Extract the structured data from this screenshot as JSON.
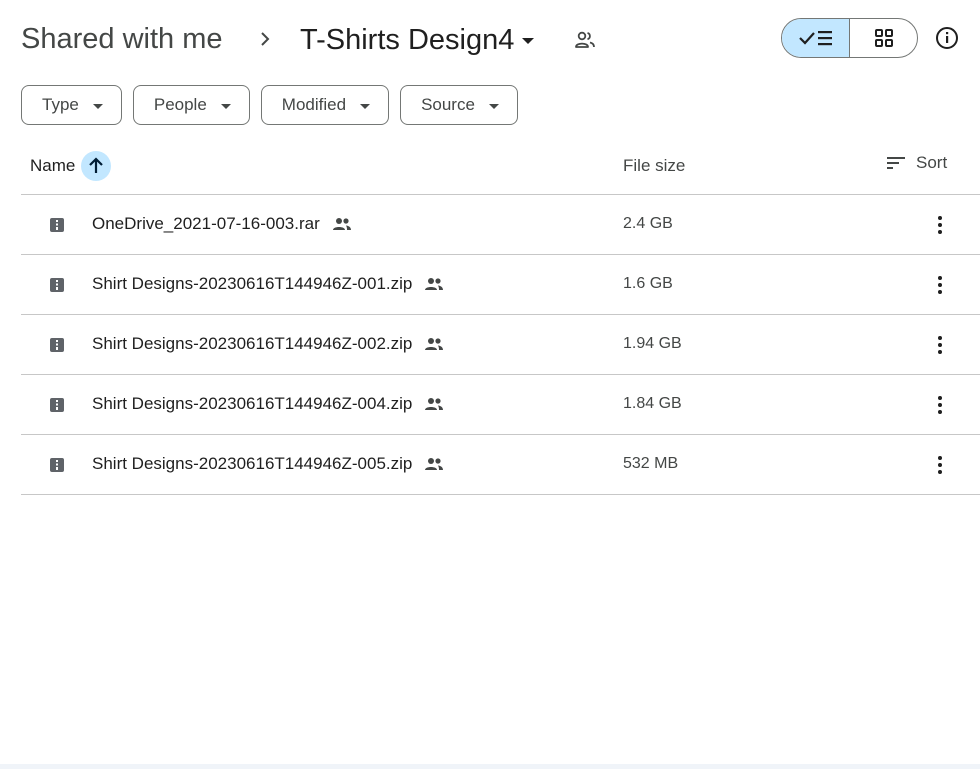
{
  "breadcrumb": {
    "root": "Shared with me",
    "current": "T-Shirts Design4"
  },
  "icons": {
    "separator": "chevron-right-icon",
    "folder_dropdown": "caret-down-icon",
    "shared": "people-icon",
    "list_view": "check-list-icon",
    "grid_view": "grid-icon",
    "info": "info-icon",
    "file": "archive-file-icon",
    "more": "more-vert-icon",
    "sort_dir": "arrow-up-icon",
    "sort": "sort-lines-icon"
  },
  "filters": [
    {
      "label": "Type"
    },
    {
      "label": "People"
    },
    {
      "label": "Modified"
    },
    {
      "label": "Source"
    }
  ],
  "table": {
    "columns": {
      "name": "Name",
      "size": "File size",
      "sort": "Sort"
    },
    "rows": [
      {
        "name": "OneDrive_2021-07-16-003.rar",
        "size": "2.4 GB"
      },
      {
        "name": "Shirt Designs-20230616T144946Z-001.zip",
        "size": "1.6 GB"
      },
      {
        "name": "Shirt Designs-20230616T144946Z-002.zip",
        "size": "1.94 GB"
      },
      {
        "name": "Shirt Designs-20230616T144946Z-004.zip",
        "size": "1.84 GB"
      },
      {
        "name": "Shirt Designs-20230616T144946Z-005.zip",
        "size": "532 MB"
      }
    ]
  },
  "colors": {
    "accent": "#c2e7ff",
    "text": "#1f1f1f",
    "muted": "#444746",
    "divider": "#c7c7c7"
  }
}
